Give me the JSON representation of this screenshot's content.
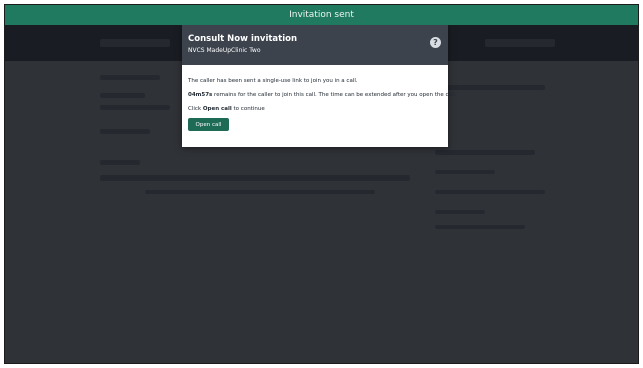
{
  "banner": {
    "text": "Invitation sent"
  },
  "modal": {
    "title": "Consult Now invitation",
    "subtitle": "NVCS MadeUpClinic Two",
    "help_icon": "help-icon",
    "line1": "The caller has been sent a single-use link to join you in a call.",
    "timer": "04m57s",
    "line2_rest": " remains for the caller to join this call. The time can be extended after you open the call.",
    "line3_prefix": "Click ",
    "line3_bold": "Open call",
    "line3_suffix": " to continue",
    "open_button_label": "Open call"
  },
  "colors": {
    "banner_bg": "#1f7a60",
    "modal_header_bg": "#3c434d",
    "button_bg": "#1d6a55"
  }
}
